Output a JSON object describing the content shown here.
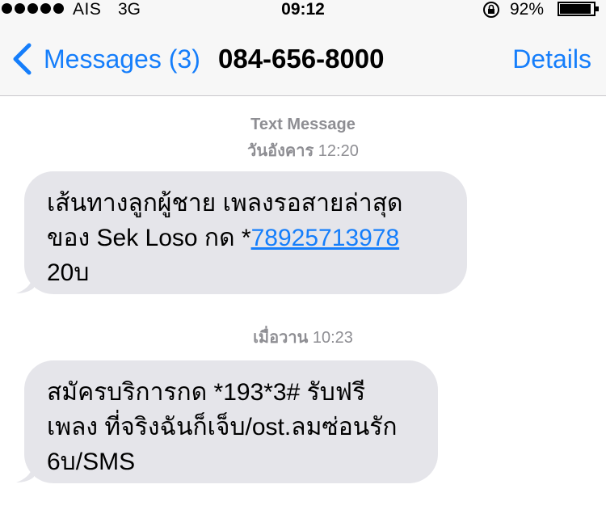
{
  "status_bar": {
    "carrier": "AIS",
    "network": "3G",
    "time": "09:12",
    "battery_percent": "92%",
    "signal_bars": 5
  },
  "nav": {
    "back_label": "Messages (3)",
    "title": "084-656-8000",
    "details_label": "Details"
  },
  "colors": {
    "accent": "#157efb",
    "bubble_bg": "#e5e5ea",
    "meta_text": "#8e8e93"
  },
  "conversation": {
    "header_type": "Text Message",
    "message_1": {
      "day": "วันอังคาร",
      "time": "12:20",
      "line1": "เส้นทางลูกผู้ชาย เพลงรอสายล่าสุด",
      "line2_prefix": "ของ Sek Loso กด *",
      "line2_link": "78925713978",
      "line3": "20บ"
    },
    "message_2": {
      "day": "เมื่อวาน",
      "time": "10:23",
      "line1": "สมัครบริการกด *193*3# รับฟรี",
      "line2": "เพลง ที่จริงฉันก็เจ็บ/ost.ลมซ่อนรัก",
      "line3": "6บ/SMS"
    }
  }
}
